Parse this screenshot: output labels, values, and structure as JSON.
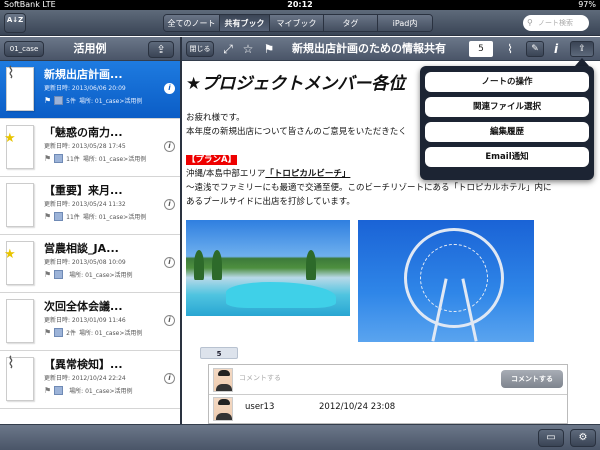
{
  "status_bar": {
    "carrier": "SoftBank  LTE",
    "time": "20:12",
    "battery": "97%"
  },
  "toolbar": {
    "sort_label": "A↓Z",
    "tabs": [
      {
        "label": "全てのノート"
      },
      {
        "label": "共有ブック"
      },
      {
        "label": "マイブック"
      },
      {
        "label": "タグ"
      },
      {
        "label": "iPad内"
      }
    ],
    "active_tab": "共有ブック",
    "search_placeholder": "ノート検索"
  },
  "sidebar": {
    "case_button": "01_case",
    "title": "活用例",
    "notes": [
      {
        "title": "新規出店計画...",
        "date": "更新日時: 2013/06/06 20:09",
        "count": "5件",
        "location": "場所: 01_case>活用例",
        "selected": true,
        "icon": "paperclip"
      },
      {
        "title": "「魅惑の南力...",
        "date": "更新日時: 2013/05/28 17:45",
        "count": "11件",
        "location": "場所: 01_case>活用例",
        "selected": false,
        "icon": "star"
      },
      {
        "title": "【重要】来月...",
        "date": "更新日時: 2013/05/24 11:32",
        "count": "11件",
        "location": "場所: 01_case>活用例",
        "selected": false,
        "icon": "none"
      },
      {
        "title": "営農相談_JA...",
        "date": "更新日時: 2013/05/08 10:09",
        "count": "",
        "location": "場所: 01_case>活用例",
        "selected": false,
        "icon": "star"
      },
      {
        "title": "次回全体会議...",
        "date": "更新日時: 2013/01/09 11:46",
        "count": "2件",
        "location": "場所: 01_case>活用例",
        "selected": false,
        "icon": "none"
      },
      {
        "title": "【異常検知】...",
        "date": "更新日時: 2012/10/24 22:24",
        "count": "",
        "location": "場所: 01_case>活用例",
        "selected": false,
        "icon": "paperclip"
      }
    ]
  },
  "note_header": {
    "close_label": "閉じる",
    "title": "新規出店計画のための情報共有",
    "comment_count": "5"
  },
  "note": {
    "heading": "★プロジェクトメンバー各位",
    "greeting": "お疲れ様です。",
    "body1": "本年度の新規出店について皆さんのご意見をいただきたく",
    "plan_tag": "【プランA】",
    "plan_location_prefix": "沖縄/本島中部エリア",
    "plan_location_emph": "「トロピカルビーチ」",
    "plan_desc1": "～遠浅でファミリーにも最適で交通至便。このビーチリゾートにある「トロピカルホテル」内に",
    "plan_desc2": "あるプールサイドに出店を打診しています。",
    "comment_count_tab": "5",
    "comment_placeholder": "コメントする",
    "comment_button": "コメントする",
    "comment": {
      "user": "user13",
      "date": "2012/10/24 23:08"
    }
  },
  "popover": {
    "items": [
      {
        "label": "ノートの操作"
      },
      {
        "label": "関連ファイル選択"
      },
      {
        "label": "編集履歴"
      },
      {
        "label": "Email通知"
      }
    ]
  },
  "icons": {
    "share": "share-icon",
    "expand": "expand-icon",
    "star": "star-icon",
    "flag": "flag-icon",
    "clip": "paperclip-icon",
    "edit": "edit-icon",
    "info": "info-icon",
    "folder": "folder-icon",
    "gear": "gear-icon"
  },
  "colors": {
    "selected_row": "#0b5dc6",
    "toolbar": "#4a5568",
    "plan_tag": "#ee0000"
  }
}
